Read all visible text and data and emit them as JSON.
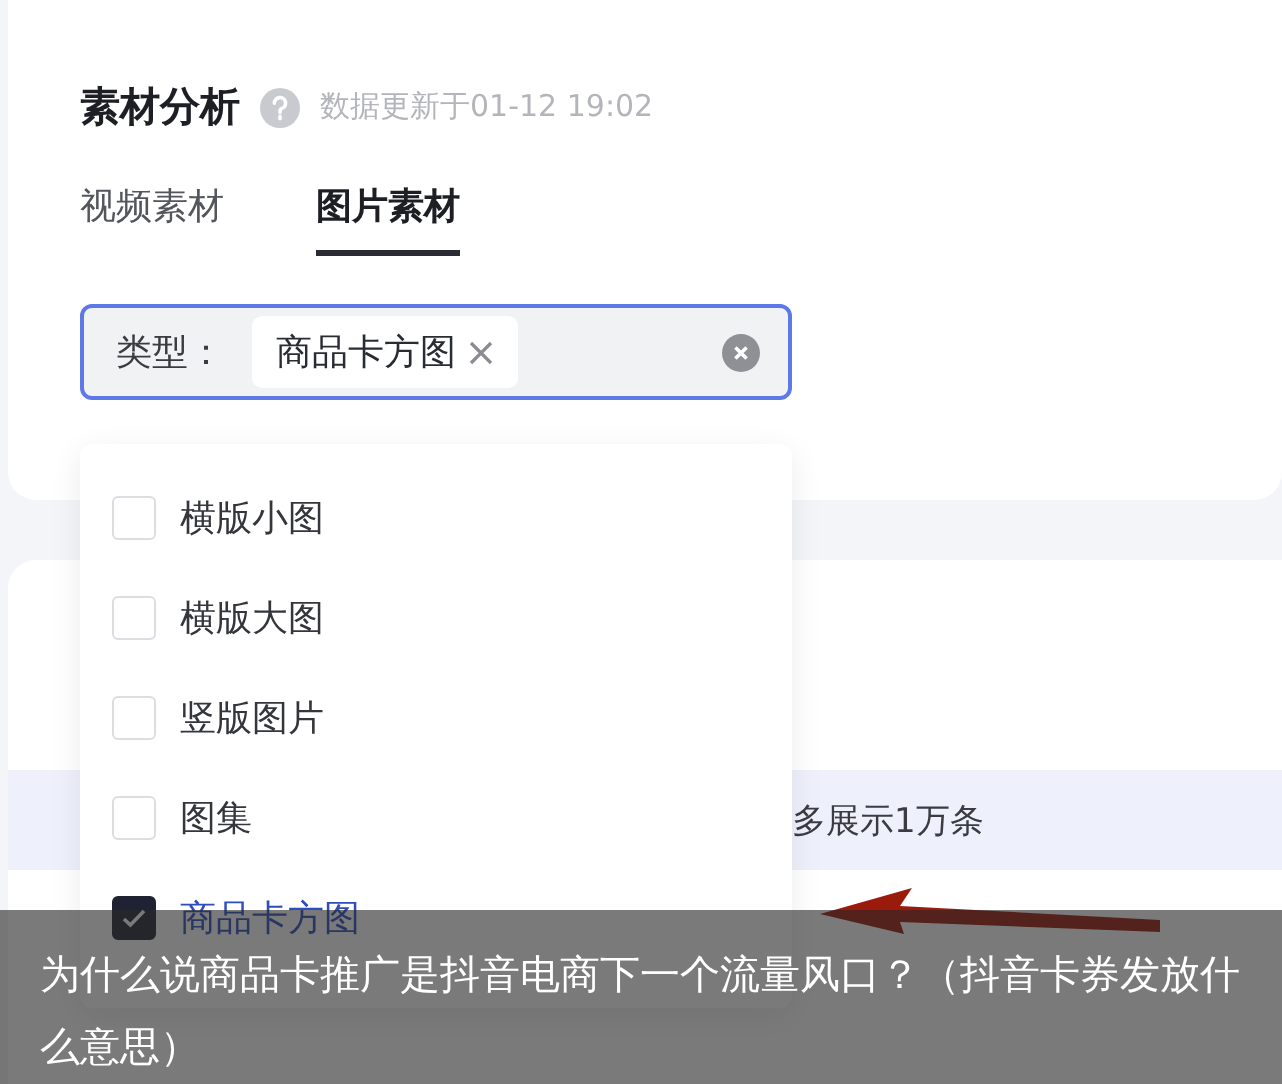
{
  "header": {
    "title": "素材分析",
    "update_time": "数据更新于01-12 19:02"
  },
  "tabs": [
    {
      "label": "视频素材",
      "selected": false
    },
    {
      "label": "图片素材",
      "selected": true
    }
  ],
  "type_filter": {
    "label": "类型：",
    "tags": [
      "商品卡方图"
    ]
  },
  "dropdown": {
    "options": [
      {
        "label": "横版小图",
        "checked": false
      },
      {
        "label": "横版大图",
        "checked": false
      },
      {
        "label": "竖版图片",
        "checked": false
      },
      {
        "label": "图集",
        "checked": false
      },
      {
        "label": "商品卡方图",
        "checked": true
      }
    ]
  },
  "notice": "多展示1万条",
  "caption": "为什么说商品卡推广是抖音电商下一个流量风口？（抖音卡券发放什么意思）"
}
